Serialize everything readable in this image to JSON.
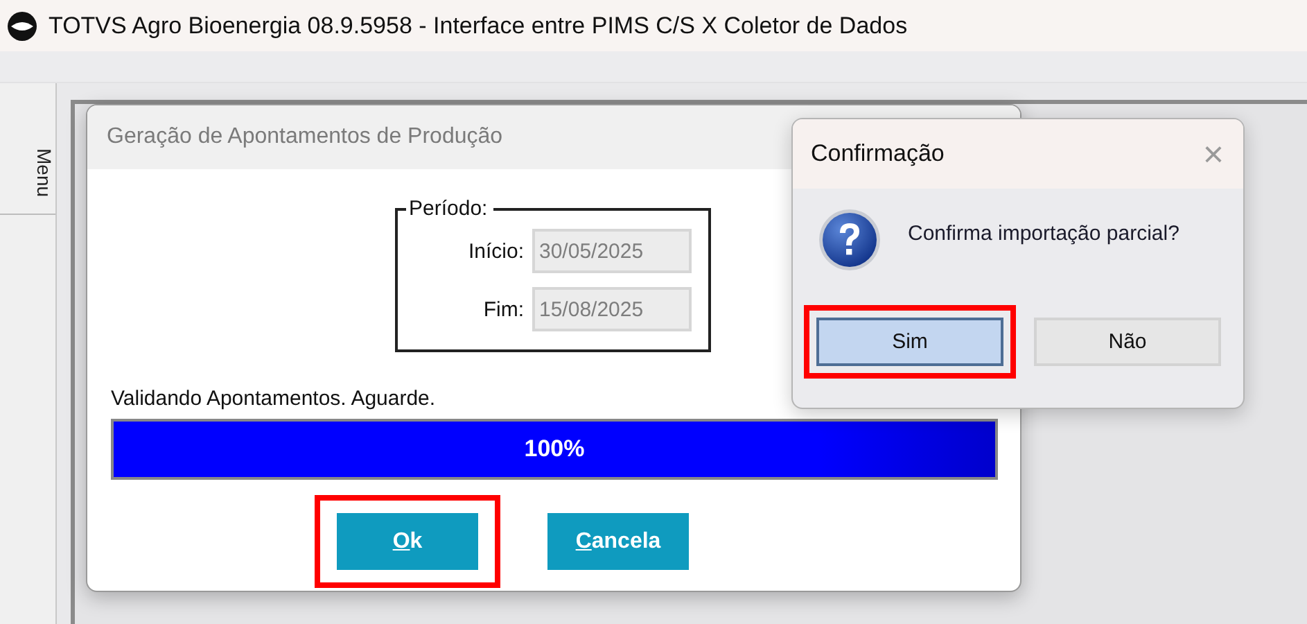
{
  "window": {
    "title": "TOTVS Agro Bioenergia 08.9.5958 - Interface entre PIMS C/S X Coletor de Dados"
  },
  "sidebar": {
    "tab": "Menu"
  },
  "production_dialog": {
    "title": "Geração de Apontamentos de Produção",
    "period": {
      "legend": "Período:",
      "fields": [
        {
          "label": "Início:",
          "value": "30/05/2025",
          "disabled": true
        },
        {
          "label": "Fim:",
          "value": "15/08/2025",
          "disabled": true
        }
      ]
    },
    "status": "Validando Apontamentos. Aguarde.",
    "progress": {
      "level": 1,
      "text": "100%"
    },
    "buttons": [
      {
        "label": "Ok",
        "highlighted": true
      },
      {
        "label": "Cancela",
        "highlighted": false
      }
    ]
  },
  "confirm_dialog": {
    "title": "Confirmação",
    "close": "×",
    "message": "Confirma importação parcial?",
    "buttons": [
      {
        "label": "Sim",
        "default": true,
        "highlighted": true
      },
      {
        "label": "Não",
        "default": false,
        "highlighted": false
      }
    ]
  }
}
